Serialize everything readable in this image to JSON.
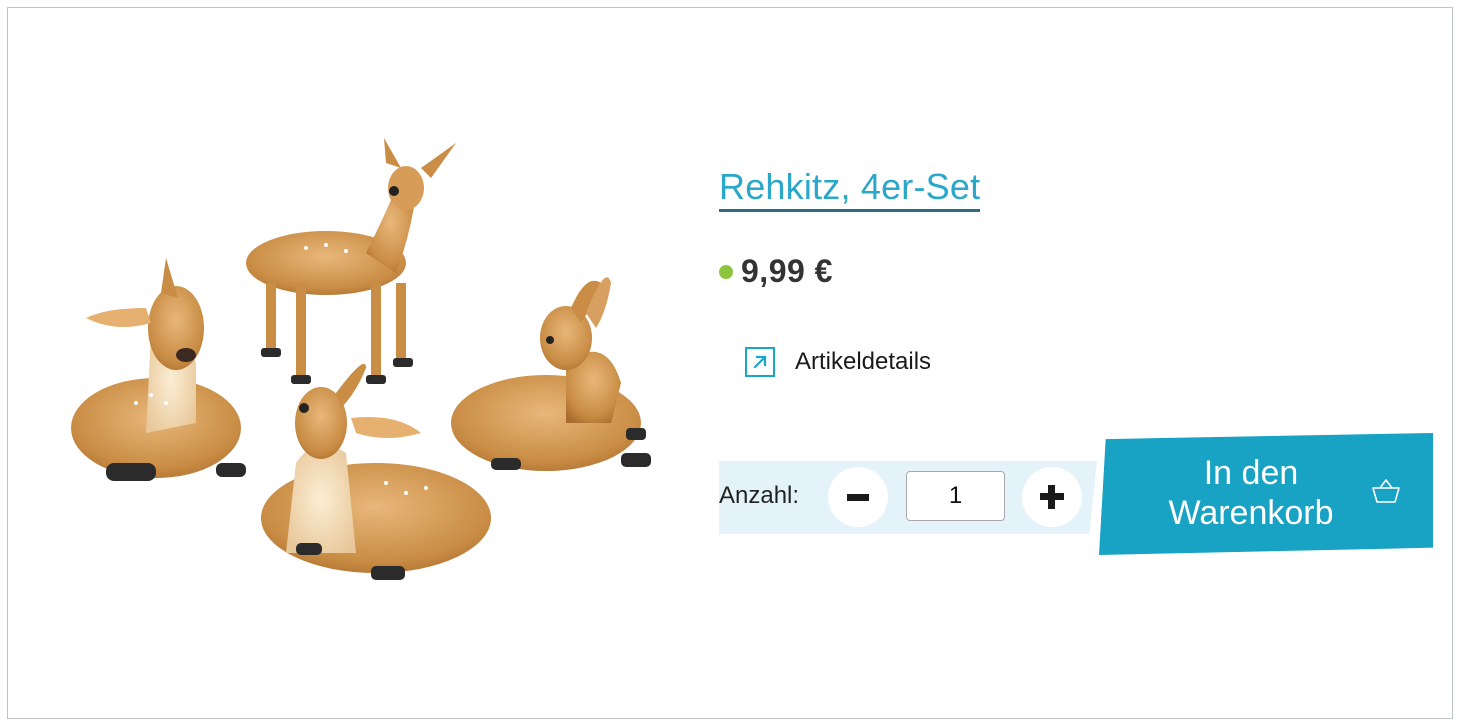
{
  "product": {
    "title": "Rehkitz, 4er-Set",
    "price": "9,99 €",
    "image_alt": "Rehkitz figures"
  },
  "details": {
    "label": "Artikeldetails",
    "icon": "external-link-icon"
  },
  "quantity": {
    "label": "Anzahl:",
    "value": "1",
    "minus_icon": "minus-icon",
    "plus_icon": "plus-icon"
  },
  "cart": {
    "label_line1": "In den",
    "label_line2": "Warenkorb",
    "icon": "basket-icon"
  },
  "colors": {
    "accent": "#18a2c4",
    "stock": "#8cc63f",
    "title_link": "#2aa7c9"
  }
}
